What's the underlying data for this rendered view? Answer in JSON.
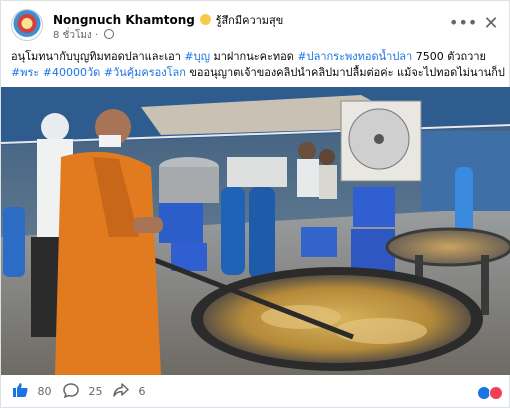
{
  "post": {
    "author": "Nongnuch Khamtong",
    "feeling": "รู้สึกมีความสุข",
    "time": "8 ชั่วโมง",
    "separator": "·",
    "more_icon": "more-horizontal-icon",
    "close_icon": "close-icon",
    "caption": {
      "line1_prefix": "อนุโมทนากับบุญทิมทอดปลาและเอา ",
      "tag_bun": "#บุญ",
      "line1_mid": " มาฝากนะคะทอด ",
      "tag_fish": "#ปลากระพงทอดน้ำปลา",
      "line1_suffix": " 7500 ตัวถวาย",
      "tag_monk": "#พระ",
      "tag_temples": "#40000วัด",
      "tag_world": "#วันคุ้มครองโลก",
      "line2_suffix": "ขออนุญาตเจ้าของคลิปนำคลิปมาปลื้มต่อค่ะ แม้จะไปทอดไม่นานก็ปลื้ม"
    }
  },
  "photo": {
    "description_icon": "frying-fish-photo"
  },
  "footer": {
    "like_count": "80",
    "comment_count": "25",
    "share_count": "6",
    "like_icon": "thumbs-up-icon",
    "comment_icon": "comment-bubble-icon",
    "share_icon": "share-arrow-icon",
    "reaction_icons": [
      "like-reaction-icon",
      "love-reaction-icon"
    ]
  },
  "colors": {
    "accent": "#1b74e4",
    "love": "#f33e58",
    "muted": "#65676b"
  }
}
